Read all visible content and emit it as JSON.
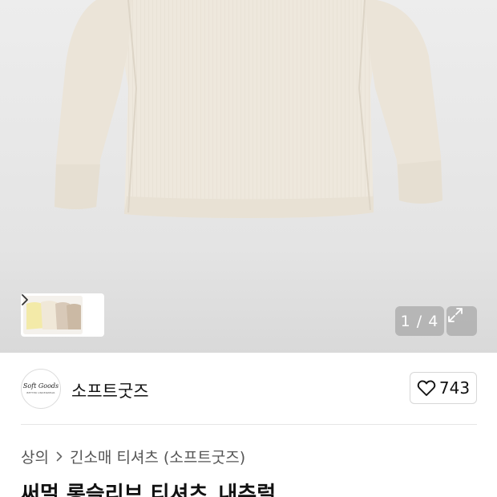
{
  "gallery": {
    "current_index": "1 / 4",
    "thumb_strip_icon": "chevron-right-icon",
    "expand_icon": "expand-icon",
    "colors": {
      "background": "#e0e0e0",
      "garment": "#eee8dd"
    }
  },
  "brand": {
    "logo_text": "Soft Goods",
    "logo_subtext": "BETTER UNDERWEAR",
    "name": "소프트굿즈",
    "like_icon": "heart-outline-icon",
    "like_count": "743"
  },
  "breadcrumb": {
    "items": [
      "상의",
      "긴소매 티셔츠 (소프트굿즈)"
    ],
    "separator_icon": "chevron-right-icon"
  },
  "product": {
    "title": "써멀 롱슬리브 티셔츠_내추럴"
  }
}
